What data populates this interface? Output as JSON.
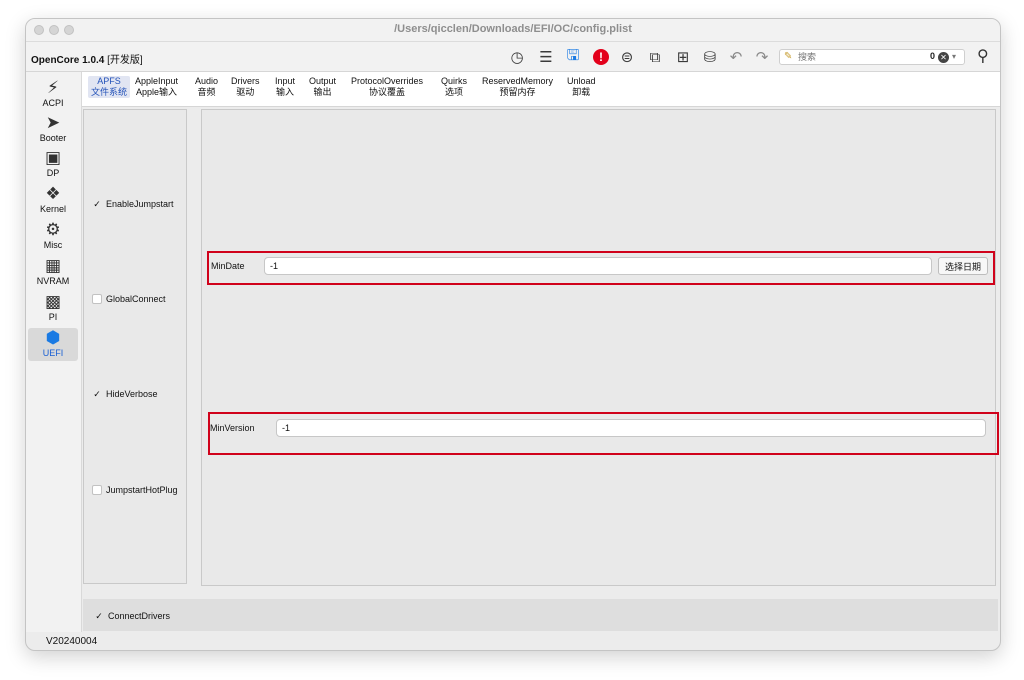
{
  "window": {
    "title": "/Users/qicclen/Downloads/EFI/OC/config.plist",
    "app_name": "OpenCore 1.0.4",
    "app_suffix": " [开发版]",
    "version": "V20240004"
  },
  "toolbar": {
    "icons": [
      "history-clock-icon",
      "list-icon",
      "save-icon",
      "alert-icon",
      "checklist-icon",
      "clone-icon",
      "import-icon",
      "database-icon",
      "undo-icon",
      "redo-icon"
    ],
    "search": {
      "value": "",
      "placeholder": "搜索",
      "count": "0"
    }
  },
  "sidebar": {
    "items": [
      {
        "label": "ACPI",
        "icon": "lightning-icon"
      },
      {
        "label": "Booter",
        "icon": "rocket-icon"
      },
      {
        "label": "DP",
        "icon": "display-icon"
      },
      {
        "label": "Kernel",
        "icon": "kernel-icon"
      },
      {
        "label": "Misc",
        "icon": "gears-icon"
      },
      {
        "label": "NVRAM",
        "icon": "chip-icon"
      },
      {
        "label": "PI",
        "icon": "apple-screen-icon"
      },
      {
        "label": "UEFI",
        "icon": "cube-icon"
      }
    ],
    "active": "UEFI"
  },
  "tabs": [
    {
      "en": "APFS",
      "zh": "文件系统"
    },
    {
      "en": "AppleInput",
      "zh": "Apple输入"
    },
    {
      "en": "Audio",
      "zh": "音频"
    },
    {
      "en": "Drivers",
      "zh": "驱动"
    },
    {
      "en": "Input",
      "zh": "输入"
    },
    {
      "en": "Output",
      "zh": "输出"
    },
    {
      "en": "ProtocolOverrides",
      "zh": "协议覆盖"
    },
    {
      "en": "Quirks",
      "zh": "选项"
    },
    {
      "en": "ReservedMemory",
      "zh": "预留内存"
    },
    {
      "en": "Unload",
      "zh": "卸载"
    }
  ],
  "checkboxes": [
    {
      "label": "EnableJumpstart",
      "checked": true
    },
    {
      "label": "GlobalConnect",
      "checked": false
    },
    {
      "label": "HideVerbose",
      "checked": true
    },
    {
      "label": "JumpstartHotPlug",
      "checked": false
    }
  ],
  "fields": {
    "min_date": {
      "label": "MinDate",
      "value": "-1",
      "button": "选择日期"
    },
    "min_version": {
      "label": "MinVersion",
      "value": "-1"
    }
  },
  "bottom": {
    "label": "ConnectDrivers",
    "checked": true
  },
  "colors": {
    "highlight": "#d0021b",
    "accent": "#1a7ae3",
    "alert": "#e3001b"
  }
}
